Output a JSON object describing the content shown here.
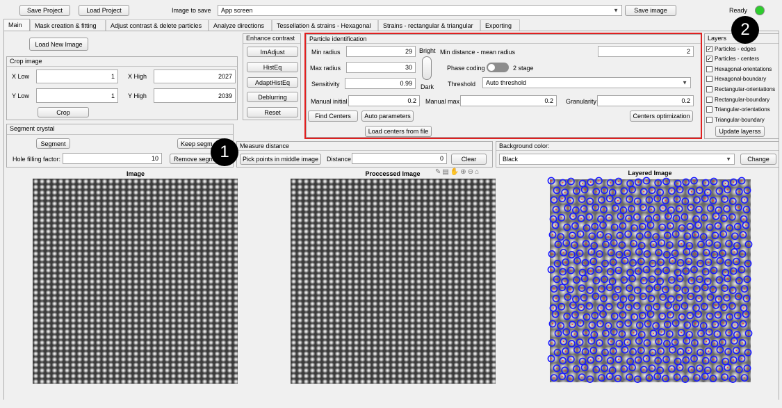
{
  "toolbar": {
    "save_project": "Save Project",
    "load_project": "Load Project",
    "image_to_save_label": "Image to save",
    "image_to_save_value": "App screen",
    "save_image": "Save image",
    "status": "Ready",
    "status_color": "#2ecc2e"
  },
  "tabs": [
    {
      "label": "Main"
    },
    {
      "label": "Mask creation & fitting"
    },
    {
      "label": "Adjust contrast & delete particles"
    },
    {
      "label": "Analyze directions"
    },
    {
      "label": "Tessellation & strains - Hexagonal"
    },
    {
      "label": "Strains - rectangular & triangular"
    },
    {
      "label": "Exporting"
    }
  ],
  "main": {
    "load_new_image": "Load New Image",
    "crop": {
      "title": "Crop image",
      "x_low_label": "X Low",
      "x_low": "1",
      "x_high_label": "X High",
      "x_high": "2027",
      "y_low_label": "Y Low",
      "y_low": "1",
      "y_high_label": "Y High",
      "y_high": "2039",
      "crop_button": "Crop"
    },
    "segment": {
      "title": "Segment crystal",
      "segment_button": "Segment",
      "keep_button": "Keep segm",
      "remove_button": "Remove segm",
      "hole_label": "Hole filling factor:",
      "hole_value": "10"
    },
    "enhance": {
      "title": "Enhance contrast",
      "buttons": [
        "ImAdjust",
        "HistEq",
        "AdaptHistEq",
        "Deblurring",
        "Reset"
      ]
    },
    "particle": {
      "title": "Particle identification",
      "min_radius_label": "Min radius",
      "min_radius": "29",
      "max_radius_label": "Max radius",
      "max_radius": "30",
      "sensitivity_label": "Sensitivity",
      "sensitivity": "0.99",
      "manual_initial_label": "Manual initial",
      "manual_initial": "0.2",
      "bright_label": "Bright",
      "dark_label": "Dark",
      "min_distance_label": "Min distance - mean radius",
      "min_distance": "2",
      "phase_coding_label": "Phase coding",
      "stage_label": "2 stage",
      "threshold_label": "Threshold",
      "threshold_value": "Auto threshold",
      "manual_max_label": "Manual max",
      "manual_max": "0.2",
      "granularity_label": "Granularity",
      "granularity": "0.2",
      "find_centers": "Find Centers",
      "auto_parameters": "Auto parameters",
      "centers_optimization": "Centers optimization",
      "load_centers": "Load centers from file",
      "highlight_color": "#e02020"
    },
    "layers": {
      "title": "Layers",
      "items": [
        {
          "label": "Particles - edges",
          "checked": true
        },
        {
          "label": "Particles - centers",
          "checked": true
        },
        {
          "label": "Hexagonal-orientations",
          "checked": false
        },
        {
          "label": "Hexagonal-boundary",
          "checked": false
        },
        {
          "label": "Rectangular-orientations",
          "checked": false
        },
        {
          "label": "Rectangular-boundary",
          "checked": false
        },
        {
          "label": "Triangular-orientations",
          "checked": false
        },
        {
          "label": "Triangular-boundary",
          "checked": false
        }
      ],
      "update_button": "Update layerss"
    },
    "measure": {
      "title": "Measure distance",
      "pick_button": "Pick points in middle image",
      "distance_label": "Distance",
      "distance_value": "0",
      "clear_button": "Clear"
    },
    "background": {
      "title": "Background color:",
      "value": "Black",
      "change_button": "Change"
    },
    "images": {
      "image_title": "Image",
      "processed_title": "Proccessed Image",
      "layered_title": "Layered Image"
    },
    "markers": [
      "1",
      "2"
    ],
    "overlay_color": "#1a1aff"
  }
}
